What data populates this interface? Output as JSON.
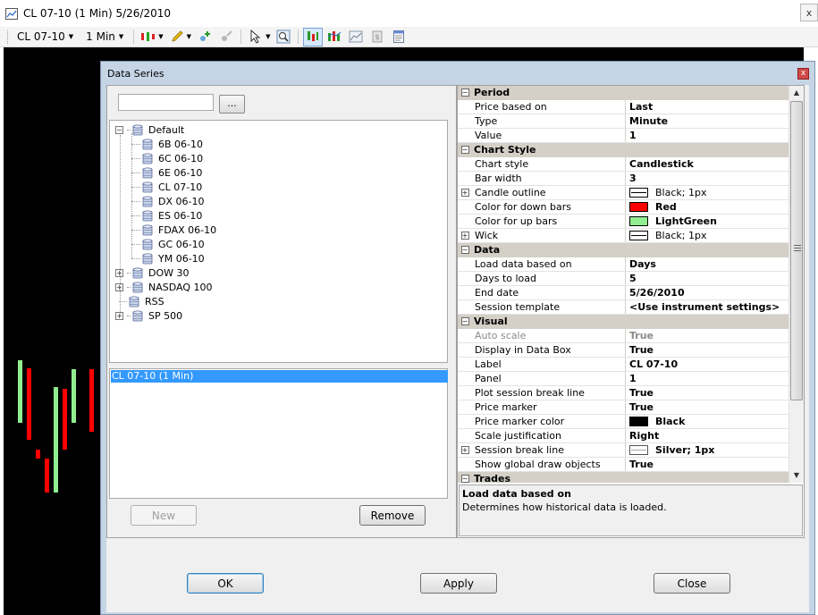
{
  "window": {
    "title": "CL 07-10 (1 Min)  5/26/2010",
    "close_glyph": "x"
  },
  "toolbar": {
    "instrument": "CL 07-10",
    "interval": "1 Min"
  },
  "dialog": {
    "title": "Data Series",
    "close_glyph": "x",
    "browse_label": "...",
    "search_value": "",
    "tree": [
      {
        "label": "Default",
        "expanded": true,
        "children": [
          "6B 06-10",
          "6C 06-10",
          "6E 06-10",
          "CL 07-10",
          "DX 06-10",
          "ES 06-10",
          "FDAX 06-10",
          "GC 06-10",
          "YM 06-10"
        ]
      },
      {
        "label": "DOW 30",
        "expanded": false
      },
      {
        "label": "NASDAQ 100",
        "expanded": false
      },
      {
        "label": "RSS",
        "expanded": null
      },
      {
        "label": "SP 500",
        "expanded": false
      }
    ],
    "series_list": [
      "CL 07-10 (1 Min)"
    ],
    "buttons": {
      "new": "New",
      "remove": "Remove",
      "ok": "OK",
      "apply": "Apply",
      "close": "Close"
    },
    "properties": [
      {
        "category": "Period",
        "items": [
          {
            "name": "Price based on",
            "value": "Last"
          },
          {
            "name": "Type",
            "value": "Minute"
          },
          {
            "name": "Value",
            "value": "1"
          }
        ]
      },
      {
        "category": "Chart Style",
        "items": [
          {
            "name": "Chart style",
            "value": "Candlestick"
          },
          {
            "name": "Bar width",
            "value": "3"
          },
          {
            "name": "Candle outline",
            "value": "Black; 1px",
            "expander": true,
            "swatch": "line",
            "normal": true
          },
          {
            "name": "Color for down bars",
            "value": "Red",
            "swatch": "#ff0000"
          },
          {
            "name": "Color for up bars",
            "value": "LightGreen",
            "swatch": "#90ee90"
          },
          {
            "name": "Wick",
            "value": "Black; 1px",
            "expander": true,
            "swatch": "line",
            "normal": true
          }
        ]
      },
      {
        "category": "Data",
        "items": [
          {
            "name": "Load data based on",
            "value": "Days"
          },
          {
            "name": "Days to load",
            "value": "5"
          },
          {
            "name": "End date",
            "value": "5/26/2010"
          },
          {
            "name": "Session template",
            "value": "<Use instrument settings>"
          }
        ]
      },
      {
        "category": "Visual",
        "items": [
          {
            "name": "Auto scale",
            "value": "True",
            "dim": true
          },
          {
            "name": "Display in Data Box",
            "value": "True"
          },
          {
            "name": "Label",
            "value": "CL 07-10"
          },
          {
            "name": "Panel",
            "value": "1"
          },
          {
            "name": "Plot session break line",
            "value": "True"
          },
          {
            "name": "Price marker",
            "value": "True"
          },
          {
            "name": "Price marker color",
            "value": "Black",
            "swatch": "#000000"
          },
          {
            "name": "Scale justification",
            "value": "Right"
          },
          {
            "name": "Session break line",
            "value": "Silver; 1px",
            "expander": true,
            "swatch": "silverline"
          },
          {
            "name": "Show global draw objects",
            "value": "True"
          }
        ]
      },
      {
        "category": "Trades",
        "items": []
      }
    ],
    "description": {
      "title": "Load data based on",
      "text": "Determines how historical data is loaded."
    }
  },
  "colors": {
    "up_bar": "#90ee90",
    "down_bar": "#ff0000",
    "chart_bg": "#000000",
    "selection": "#3399ff"
  },
  "icons": [
    "chart-app-icon",
    "candlestick-icon",
    "pencil-icon",
    "add-indicator-icon",
    "strategy-icon",
    "pointer-icon",
    "zoom-icon",
    "data-series-icon",
    "bar-chart-icon",
    "area-chart-icon",
    "money-icon",
    "properties-icon",
    "database-icon"
  ]
}
